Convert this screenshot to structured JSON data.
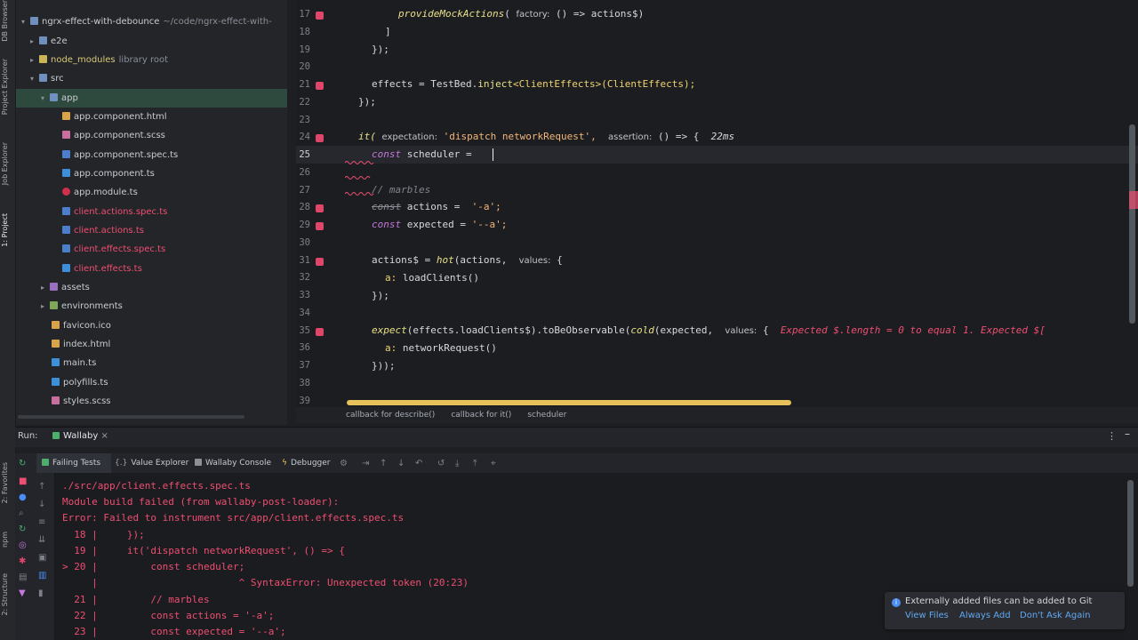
{
  "left_strip": {
    "items": [
      "DB Browser",
      "Project Explorer",
      "Job Explorer",
      "1: Project"
    ],
    "bottom_items": [
      "2: Favorites",
      "npm",
      "2: Structure"
    ]
  },
  "tree": {
    "root_name": "ngrx-effect-with-debounce",
    "root_path": "~/code/ngrx-effect-with-",
    "items": [
      {
        "label": "e2e",
        "hint": ""
      },
      {
        "label": "node_modules",
        "hint": "library root"
      },
      {
        "label": "src",
        "hint": ""
      },
      {
        "label": "app",
        "hint": ""
      },
      {
        "label": "app.component.html",
        "hint": ""
      },
      {
        "label": "app.component.scss",
        "hint": ""
      },
      {
        "label": "app.component.spec.ts",
        "hint": ""
      },
      {
        "label": "app.component.ts",
        "hint": ""
      },
      {
        "label": "app.module.ts",
        "hint": ""
      },
      {
        "label": "client.actions.spec.ts",
        "hint": ""
      },
      {
        "label": "client.actions.ts",
        "hint": ""
      },
      {
        "label": "client.effects.spec.ts",
        "hint": ""
      },
      {
        "label": "client.effects.ts",
        "hint": ""
      },
      {
        "label": "assets",
        "hint": ""
      },
      {
        "label": "environments",
        "hint": ""
      },
      {
        "label": "favicon.ico",
        "hint": ""
      },
      {
        "label": "index.html",
        "hint": ""
      },
      {
        "label": "main.ts",
        "hint": ""
      },
      {
        "label": "polyfills.ts",
        "hint": ""
      },
      {
        "label": "styles.scss",
        "hint": ""
      }
    ]
  },
  "editor": {
    "lines": [
      {
        "n": "17",
        "bp": true
      },
      {
        "n": "18",
        "bp": false
      },
      {
        "n": "19",
        "bp": false
      },
      {
        "n": "20",
        "bp": false
      },
      {
        "n": "21",
        "bp": true
      },
      {
        "n": "22",
        "bp": false
      },
      {
        "n": "23",
        "bp": false
      },
      {
        "n": "24",
        "bp": true
      },
      {
        "n": "25",
        "bp": false
      },
      {
        "n": "26",
        "bp": false
      },
      {
        "n": "27",
        "bp": false
      },
      {
        "n": "28",
        "bp": true
      },
      {
        "n": "29",
        "bp": true
      },
      {
        "n": "30",
        "bp": false
      },
      {
        "n": "31",
        "bp": true
      },
      {
        "n": "32",
        "bp": false
      },
      {
        "n": "33",
        "bp": false
      },
      {
        "n": "34",
        "bp": false
      },
      {
        "n": "35",
        "bp": true
      },
      {
        "n": "36",
        "bp": false
      },
      {
        "n": "37",
        "bp": false
      },
      {
        "n": "38",
        "bp": false
      },
      {
        "n": "39",
        "bp": false
      }
    ],
    "code": {
      "l17_fn": "provideMockActions",
      "l17_hint": "factory:",
      "l17_rest": "() => actions$)",
      "l18": "]",
      "l19": "});",
      "l21_a": "effects = TestBed.",
      "l21_fn": "inject",
      "l21_b": "<ClientEffects>(ClientEffects);",
      "l22": "});",
      "l24_it": "it(",
      "l24_h1": "expectation:",
      "l24_str": "'dispatch networkRequest',",
      "l24_h2": "assertion:",
      "l24_rest": "() => {",
      "l24_time": "22ms",
      "l25_kw": "const",
      "l25_rest": "scheduler = ",
      "l27_cmt": "// marbles",
      "l28_kw": "const",
      "l28_a": "actions = ",
      "l28_str": "'-a';",
      "l29_kw": "const",
      "l29_a": "expected = ",
      "l29_str": "'--a';",
      "l31_a": "actions$ = ",
      "l31_fn": "hot",
      "l31_b": "(actions,",
      "l31_hint": "values:",
      "l31_c": "{",
      "l32_prop": "a:",
      "l32_rest": "loadClients()",
      "l33": "});",
      "l35_fn": "expect",
      "l35_a": "(effects.loadClients$).toBeObservable(",
      "l35_fn2": "cold",
      "l35_b": "(expected,",
      "l35_hint": "values:",
      "l35_c": "{",
      "l35_err": "Expected $.length = 0 to equal 1. Expected $[",
      "l36_prop": "a:",
      "l36_rest": "networkRequest()",
      "l37": "}));"
    }
  },
  "breadcrumbs": [
    "callback for describe()",
    "callback for it()",
    "scheduler"
  ],
  "run_panel": {
    "run_label": "Run:",
    "tab_label": "Wallaby",
    "tabs": [
      "Failing Tests",
      "Value Explorer",
      "Wallaby Console",
      "Debugger"
    ],
    "console_lines": [
      "./src/app/client.effects.spec.ts",
      "Module build failed (from wallaby-post-loader):",
      "Error: Failed to instrument src/app/client.effects.spec.ts",
      "  18 |     });",
      "  19 |     it('dispatch networkRequest', () => {",
      "> 20 |         const scheduler;",
      "     |                        ^ SyntaxError: Unexpected token (20:23)",
      "  21 |         // marbles",
      "  22 |         const actions = '-a';",
      "  23 |         const expected = '--a';"
    ]
  },
  "notification": {
    "message": "Externally added files can be added to Git",
    "actions": [
      "View Files",
      "Always Add",
      "Don't Ask Again"
    ]
  },
  "colors": {
    "accent_error": "#ef4e72",
    "breakpoint": "#e0456a",
    "link": "#62a8f0",
    "scrollbar_highlight": "#e7c25a"
  }
}
